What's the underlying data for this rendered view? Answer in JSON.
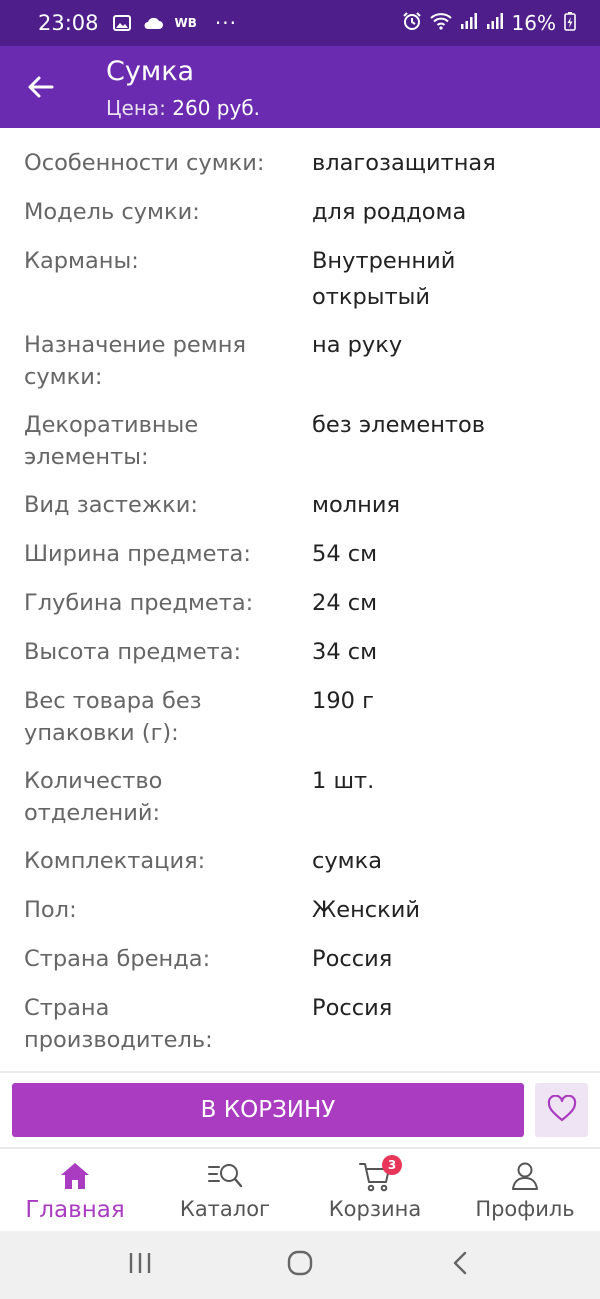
{
  "status_bar": {
    "time": "23:08",
    "wb_label": "WB",
    "more": "···",
    "battery": "16%"
  },
  "appbar": {
    "title": "Сумка",
    "price_label": "Цена:",
    "price_value": "260 руб."
  },
  "specs": [
    {
      "key": "Особенности сумки:",
      "value": "влагозащитная"
    },
    {
      "key": "Модель сумки:",
      "value": "для роддома"
    },
    {
      "key": "Карманы:",
      "value": "Внутренний открытый"
    },
    {
      "key": "Назначение ремня сумки:",
      "value": "на руку"
    },
    {
      "key": "Декоративные элементы:",
      "value": "без элементов"
    },
    {
      "key": "Вид застежки:",
      "value": "молния"
    },
    {
      "key": "Ширина предмета:",
      "value": "54 см"
    },
    {
      "key": "Глубина предмета:",
      "value": "24 см"
    },
    {
      "key": "Высота предмета:",
      "value": "34 см"
    },
    {
      "key": "Вес товара без упаковки (г):",
      "value": "190 г"
    },
    {
      "key": "Количество отделений:",
      "value": "1 шт."
    },
    {
      "key": "Комплектация:",
      "value": "сумка"
    },
    {
      "key": "Пол:",
      "value": "Женский"
    },
    {
      "key": "Страна бренда:",
      "value": "Россия"
    },
    {
      "key": "Страна производитель:",
      "value": "Россия"
    }
  ],
  "actions": {
    "add_to_cart": "В КОРЗИНУ"
  },
  "bottom_nav": {
    "home": "Главная",
    "catalog": "Каталог",
    "cart": "Корзина",
    "cart_badge": "3",
    "profile": "Профиль"
  },
  "colors": {
    "status_bar": "#4e1f8a",
    "app_bar": "#6b2bb0",
    "accent": "#a93cc0",
    "badge": "#e8355a"
  }
}
